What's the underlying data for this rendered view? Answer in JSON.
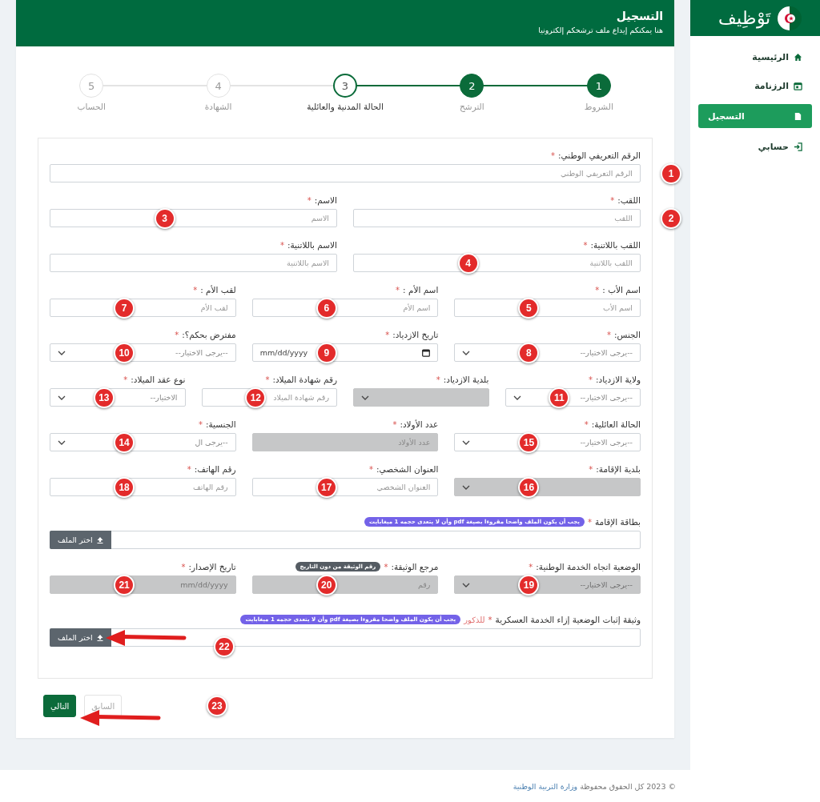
{
  "sidebar": {
    "logo": "تَوْظِيف",
    "items": [
      {
        "label": "الرئيسية",
        "selected": false
      },
      {
        "label": "الرزنامة",
        "selected": false
      },
      {
        "label": "التسجيل",
        "selected": true
      },
      {
        "label": "حسابي",
        "selected": false
      }
    ]
  },
  "header": {
    "title": "التسجيل",
    "subtitle": "هنا يمكنكم إيداع ملف ترشحكم إلكترونيا"
  },
  "steps": [
    {
      "number": "1",
      "label": "الشروط",
      "done": true,
      "current": false
    },
    {
      "number": "2",
      "label": "الترشح",
      "done": true,
      "current": false
    },
    {
      "number": "3",
      "label": "الحالة المدنية والعائلية",
      "done": false,
      "current": true
    },
    {
      "number": "4",
      "label": "الشهادة",
      "done": false,
      "current": false
    },
    {
      "number": "5",
      "label": "الحساب",
      "done": false,
      "current": false
    }
  ],
  "form": {
    "rows": [
      {
        "fields": [
          {
            "kind": "text",
            "label": "الرقم التعريفي الوطني:",
            "mark": "*",
            "placeholder": "الرقم التعريفي الوطني",
            "disabled": false,
            "marker": {
              "number": "1",
              "kind": "outside"
            }
          }
        ]
      },
      {
        "fields": [
          {
            "kind": "text",
            "label": "اللقب:",
            "mark": "*",
            "placeholder": "اللقب",
            "disabled": false,
            "marker": {
              "number": "2",
              "kind": "outside"
            }
          },
          {
            "kind": "text",
            "label": "الاسم:",
            "mark": "*",
            "placeholder": "الاسم",
            "disabled": false,
            "marker": {
              "number": "3",
              "kind": "inside"
            }
          }
        ]
      },
      {
        "fields": [
          {
            "kind": "text",
            "label": "اللقب باللاتنية:",
            "mark": "*",
            "placeholder": "اللقب باللاتنية",
            "disabled": false,
            "marker": {
              "number": "4",
              "kind": "inside"
            }
          },
          {
            "kind": "text",
            "label": "الاسم باللاتنية:",
            "mark": "*",
            "placeholder": "الاسم باللاتنية",
            "disabled": false
          }
        ]
      },
      {
        "fields": [
          {
            "kind": "text",
            "label": "اسم الأب :",
            "mark": "*",
            "placeholder": "اسم الأب",
            "disabled": false,
            "marker": {
              "number": "5",
              "kind": "inside"
            }
          },
          {
            "kind": "text",
            "label": "اسم الأم :",
            "mark": "*",
            "placeholder": "اسم الأم",
            "disabled": false,
            "marker": {
              "number": "6",
              "kind": "inside"
            }
          },
          {
            "kind": "text",
            "label": "لقب الأم :",
            "mark": "*",
            "placeholder": "لقب الأم",
            "disabled": false,
            "marker": {
              "number": "7",
              "kind": "inside"
            }
          }
        ]
      },
      {
        "fields": [
          {
            "kind": "select",
            "label": "الجنس:",
            "mark": "*",
            "placeholder": "--يرجى الاختيار--",
            "disabled": false,
            "marker": {
              "number": "8",
              "kind": "inside"
            }
          },
          {
            "kind": "date",
            "label": "تاريخ الازدياد:",
            "mark": "*",
            "placeholder": "mm/dd/yyyy",
            "disabled": false,
            "marker": {
              "number": "9",
              "kind": "inside"
            }
          },
          {
            "kind": "select",
            "label": "مفترض بحكم؟:",
            "mark": "*",
            "placeholder": "--يرجى الاختيار--",
            "disabled": false,
            "marker": {
              "number": "10",
              "kind": "inside"
            }
          }
        ]
      },
      {
        "fields": [
          {
            "kind": "select",
            "label": "ولاية الازدياد:",
            "mark": "*",
            "placeholder": "--يرجى الاختيار--",
            "disabled": false,
            "marker": {
              "number": "11",
              "kind": "inside"
            }
          },
          {
            "kind": "select",
            "label": "بلدية الازدياد:",
            "mark": "*",
            "disabled": true
          },
          {
            "kind": "text",
            "label": "رقم شهادة الميلاد:",
            "mark": "*",
            "placeholder": "رقم شهادة الميلاد",
            "disabled": false,
            "marker": {
              "number": "12",
              "kind": "inside"
            }
          },
          {
            "kind": "select",
            "label": "نوع عقد الميلاد:",
            "mark": "*",
            "placeholder": "الاختيار--",
            "disabled": false,
            "marker": {
              "number": "13",
              "kind": "inside"
            }
          }
        ]
      },
      {
        "fields": [
          {
            "kind": "select",
            "label": "الحالة العائلية:",
            "mark": "*",
            "placeholder": "--يرجى الاختيار--",
            "disabled": false,
            "marker": {
              "number": "15",
              "kind": "inside"
            }
          },
          {
            "kind": "text",
            "label": "عدد الأولاد:",
            "mark": "*",
            "placeholder": "عدد الأولاد",
            "disabled": true
          },
          {
            "kind": "select",
            "label": "الجنسية:",
            "mark": "*",
            "placeholder": "--يرجى ال",
            "disabled": false,
            "marker": {
              "number": "14",
              "kind": "inside"
            }
          }
        ]
      },
      {
        "fields": [
          {
            "kind": "select",
            "label": "بلدية الإقامة:",
            "mark": "*",
            "disabled": true,
            "marker": {
              "number": "16",
              "kind": "inside"
            }
          },
          {
            "kind": "text",
            "label": "العنوان الشخصي:",
            "mark": "*",
            "placeholder": "العنوان الشخصي",
            "disabled": false,
            "marker": {
              "number": "17",
              "kind": "inside"
            }
          },
          {
            "kind": "text",
            "label": "رقم الهاتف:",
            "mark": "*",
            "placeholder": "رقم الهاتف",
            "disabled": false,
            "marker": {
              "number": "18",
              "kind": "inside"
            }
          }
        ]
      },
      {
        "fields": [
          {
            "kind": "file",
            "label": "بطاقة الإقامة",
            "mark": "*",
            "hint": {
              "text": "يجب أن يكون الملف واضحا مقروءا بصيغة pdf وأن لا يتعدى حجمه 1 ميغابايت",
              "kind": "info"
            },
            "button": "اختر الملف"
          }
        ]
      },
      {
        "fields": [
          {
            "kind": "select",
            "label": "الوضعية اتجاه الخدمة الوطنية:",
            "mark": "*",
            "placeholder": "--يرجى الاختيار--",
            "disabled": true,
            "marker": {
              "number": "19",
              "kind": "inside"
            }
          },
          {
            "kind": "text",
            "label": "مرجع الوثيقة:",
            "mark": "*",
            "hint": {
              "text": "رقم الوثيقة من دون التاريخ",
              "kind": "dark"
            },
            "placeholder": "رقم",
            "disabled": true,
            "marker": {
              "number": "20",
              "kind": "inside"
            }
          },
          {
            "kind": "date",
            "label": "تاريخ الإصدار:",
            "mark": "*",
            "placeholder": "mm/dd/yyyy",
            "disabled": true,
            "marker": {
              "number": "21",
              "kind": "inside"
            }
          }
        ]
      },
      {
        "fields": [
          {
            "kind": "file",
            "label": "وثيقة إثبات الوضعية إزاء الخدمة العسكرية",
            "mark": "*",
            "note": "للذكور",
            "hint": {
              "text": "يجب أن يكون الملف واضحا مقروءا بصيغة pdf وأن لا يتعدى حجمه 1 ميغابايت",
              "kind": "info"
            },
            "button": "اختر الملف",
            "pointer": true,
            "marker": {
              "number": "22",
              "kind": "below"
            }
          }
        ]
      }
    ]
  },
  "actions": {
    "next": "التالي",
    "previous": "السابق",
    "pointer": true,
    "marker": "23"
  },
  "footer": {
    "text": "© 2023 كل الحقوق محفوظة",
    "link": "وزارة التربية الوطنية"
  }
}
